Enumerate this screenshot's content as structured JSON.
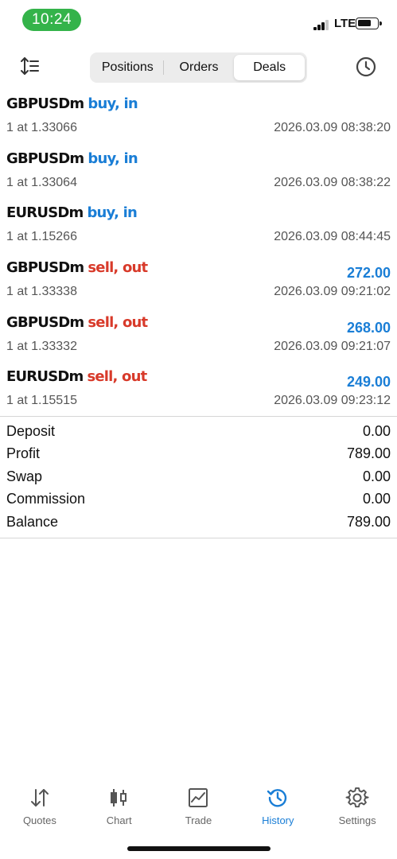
{
  "status": {
    "time": "10:24",
    "network": "LTE"
  },
  "header": {
    "tabs": [
      {
        "label": "Positions"
      },
      {
        "label": "Orders"
      },
      {
        "label": "Deals"
      }
    ],
    "active_tab": "Deals"
  },
  "deals": [
    {
      "symbol": "GBPUSDm",
      "side": "buy, in",
      "qty": "1 at 1.33066",
      "time": "2026.03.09 08:38:20",
      "profit": ""
    },
    {
      "symbol": "GBPUSDm",
      "side": "buy, in",
      "qty": "1 at 1.33064",
      "time": "2026.03.09 08:38:22",
      "profit": ""
    },
    {
      "symbol": "EURUSDm",
      "side": "buy, in",
      "qty": "1 at 1.15266",
      "time": "2026.03.09 08:44:45",
      "profit": ""
    },
    {
      "symbol": "GBPUSDm",
      "side": "sell, out",
      "qty": "1 at 1.33338",
      "time": "2026.03.09 09:21:02",
      "profit": "272.00"
    },
    {
      "symbol": "GBPUSDm",
      "side": "sell, out",
      "qty": "1 at 1.33332",
      "time": "2026.03.09 09:21:07",
      "profit": "268.00"
    },
    {
      "symbol": "EURUSDm",
      "side": "sell, out",
      "qty": "1 at 1.15515",
      "time": "2026.03.09 09:23:12",
      "profit": "249.00"
    }
  ],
  "summary": {
    "deposit_label": "Deposit",
    "deposit": "0.00",
    "profit_label": "Profit",
    "profit": "789.00",
    "swap_label": "Swap",
    "swap": "0.00",
    "commission_label": "Commission",
    "commission": "0.00",
    "balance_label": "Balance",
    "balance": "789.00"
  },
  "tabbar": [
    {
      "label": "Quotes",
      "icon": "quotes-arrows-icon"
    },
    {
      "label": "Chart",
      "icon": "candlestick-icon"
    },
    {
      "label": "Trade",
      "icon": "trade-chart-icon"
    },
    {
      "label": "History",
      "icon": "history-clock-icon"
    },
    {
      "label": "Settings",
      "icon": "gear-icon"
    }
  ],
  "colors": {
    "buy": "#1a7ed6",
    "sell": "#d83a2a",
    "accent": "#1a7ed6",
    "time_pill": "#34b34a"
  }
}
